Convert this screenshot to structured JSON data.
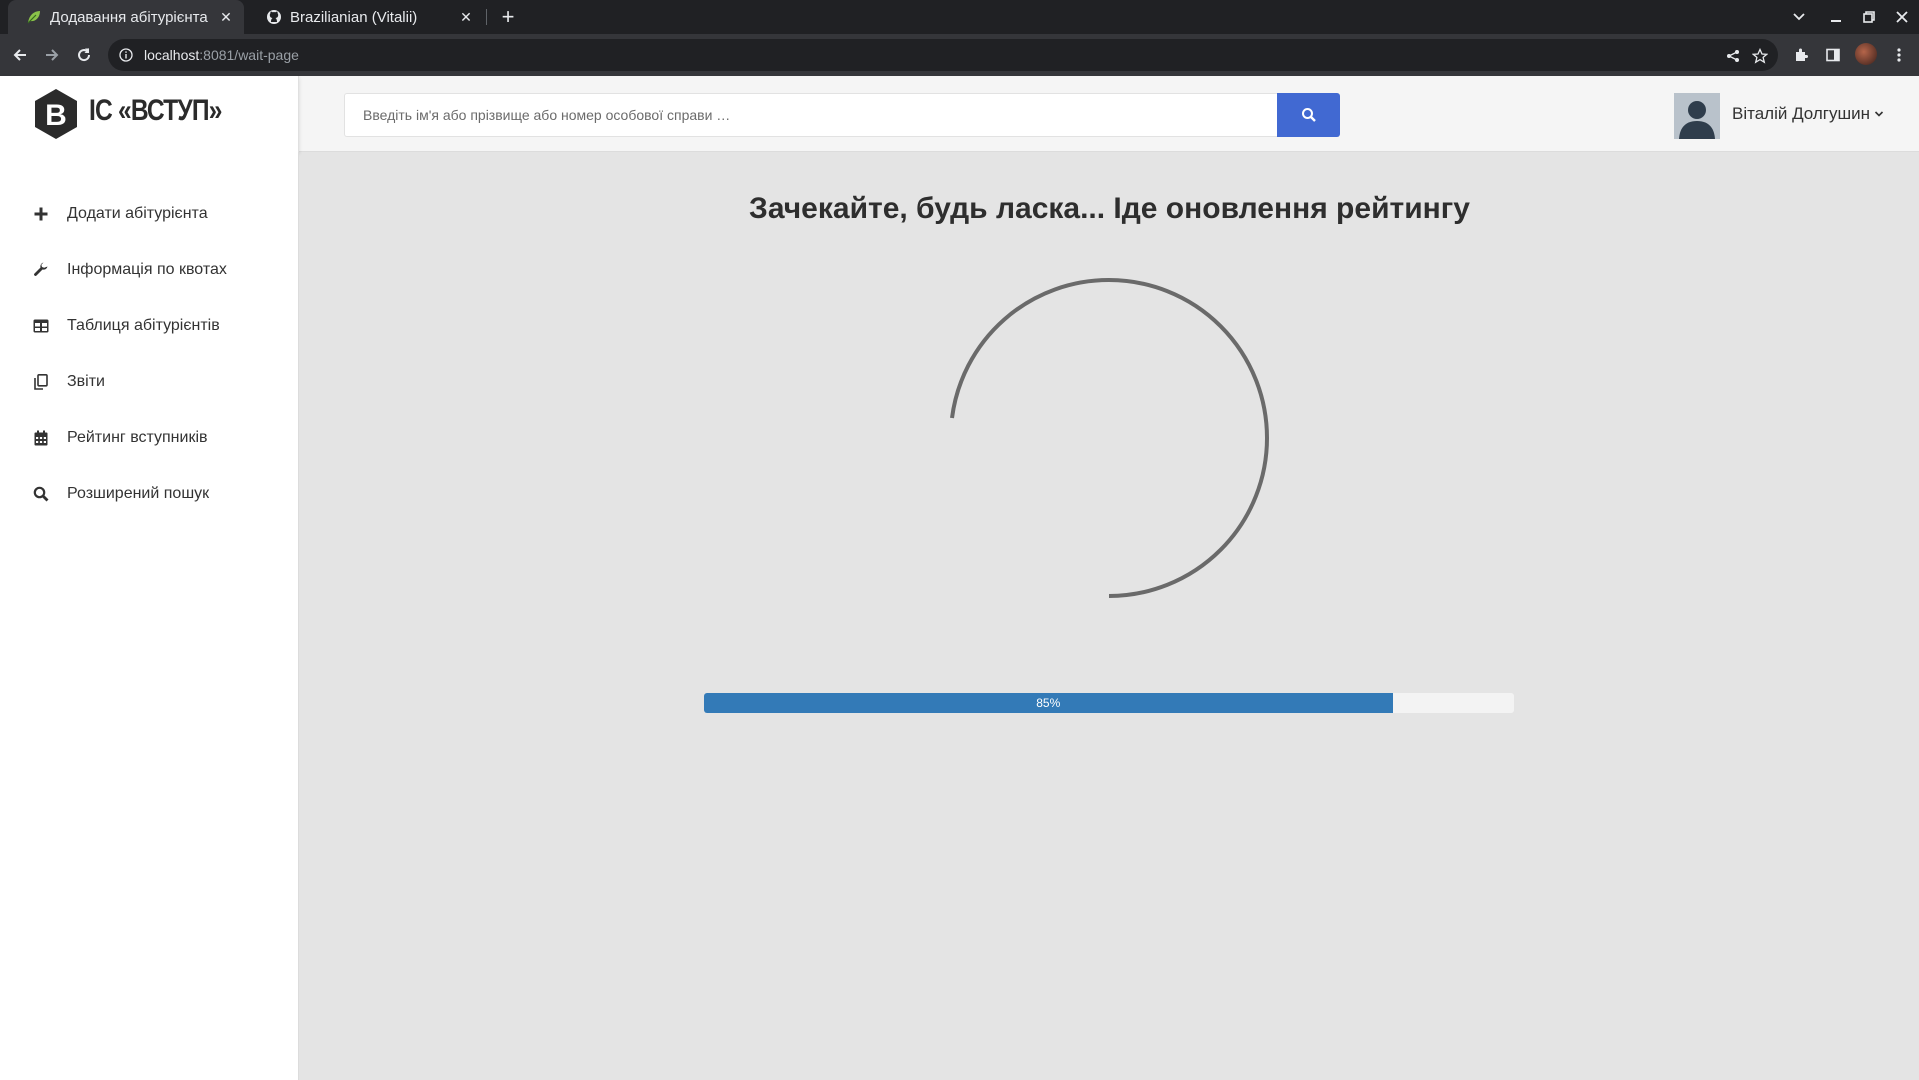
{
  "browser": {
    "tabs": [
      {
        "title": "Додавання абітурієнта",
        "active": true,
        "favicon": "leaf-icon"
      },
      {
        "title": "Brazilianian (Vitalii)",
        "active": false,
        "favicon": "github-icon"
      }
    ],
    "url_host": "localhost",
    "url_rest": ":8081/wait-page"
  },
  "header": {
    "brand_letter": "B",
    "brand_text": "ІС «ВСТУП»",
    "search_placeholder": "Введіть ім'я або прізвище або номер особової справи …",
    "user_name": "Віталій Долгушин"
  },
  "sidebar": {
    "items": [
      {
        "label": "Додати абітурієнта",
        "icon": "plus-icon"
      },
      {
        "label": "Інформація по квотах",
        "icon": "wrench-icon"
      },
      {
        "label": "Таблиця абітурієнтів",
        "icon": "table-icon"
      },
      {
        "label": "Звіти",
        "icon": "copy-icon"
      },
      {
        "label": "Рейтинг вступників",
        "icon": "calendar-icon"
      },
      {
        "label": "Розширений пошук",
        "icon": "search-icon"
      }
    ]
  },
  "main": {
    "title": "Зачекайте, будь ласка... Іде оновлення рейтингу",
    "progress": {
      "value": 85,
      "label": "85%"
    }
  },
  "colors": {
    "accent": "#4169d2",
    "progress": "#337ab7",
    "page_bg": "#e4e4e4"
  }
}
